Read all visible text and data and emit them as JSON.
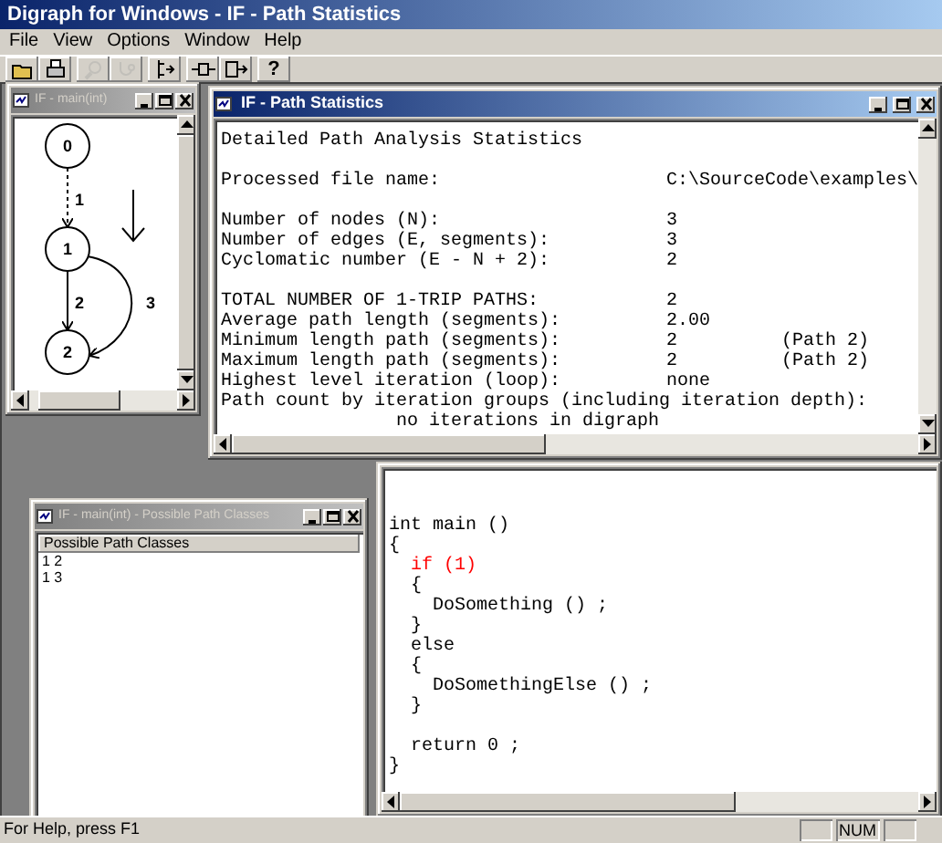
{
  "window": {
    "title": "Digraph for Windows - IF - Path Statistics"
  },
  "menu": [
    "File",
    "View",
    "Options",
    "Window",
    "Help"
  ],
  "toolbar": [
    {
      "kind": "open",
      "disabled": false
    },
    {
      "kind": "print",
      "disabled": false
    },
    {
      "kind": "zoom",
      "disabled": true
    },
    {
      "kind": "curve",
      "disabled": true
    },
    {
      "kind": "split",
      "disabled": false
    },
    {
      "kind": "node",
      "disabled": false
    },
    {
      "kind": "move",
      "disabled": false
    },
    {
      "kind": "help",
      "label": "?",
      "disabled": false
    }
  ],
  "graph_window": {
    "title": "IF - main(int)",
    "active": false,
    "nodes": [
      {
        "label": "0"
      },
      {
        "label": "1"
      },
      {
        "label": "2"
      }
    ],
    "edges": [
      {
        "kind": "dotted",
        "label": "1"
      },
      {
        "kind": "straight",
        "label": "2"
      },
      {
        "kind": "curved",
        "label": "3"
      }
    ]
  },
  "stats_window": {
    "title": "IF - Path Statistics",
    "active": true,
    "sections": [
      [
        {
          "kind": "line",
          "label": "Detailed Path Analysis Statistics"
        }
      ],
      [
        {
          "kind": "pair",
          "label": "Processed file name:",
          "value": "C:\\SourceCode\\examples\\"
        }
      ],
      [
        {
          "kind": "pair",
          "label": "Number of nodes (N):",
          "value": "3"
        },
        {
          "kind": "pair",
          "label": "Number of edges (E, segments):",
          "value": "3"
        },
        {
          "kind": "pair",
          "label": "Cyclomatic number (E - N + 2):",
          "value": "2"
        }
      ],
      [
        {
          "kind": "pair",
          "label": "TOTAL NUMBER OF 1-TRIP PATHS:",
          "value": "2"
        },
        {
          "kind": "pair",
          "label": "Average path length (segments):",
          "value": "2.00"
        },
        {
          "kind": "pair",
          "label": "Minimum length path (segments):",
          "value": "2",
          "note": "(Path 2)"
        },
        {
          "kind": "pair",
          "label": "Maximum length path (segments):",
          "value": "2",
          "note": "(Path 2)"
        },
        {
          "kind": "pair",
          "label": "Highest level iteration (loop):",
          "value": "none"
        },
        {
          "kind": "line",
          "label": "Path count by iteration groups (including iteration depth):"
        },
        {
          "kind": "indented",
          "label": "no iterations in digraph"
        }
      ]
    ]
  },
  "classes_window": {
    "title": "IF - main(int) - Possible Path Classes",
    "active": false,
    "header": "Possible Path Classes",
    "rows": [
      "1 2",
      "1 3"
    ]
  },
  "code_window": {
    "lines": [
      {
        "kind": "code",
        "text": "int main ()",
        "highlighted": false
      },
      {
        "kind": "code",
        "text": "{",
        "highlighted": false
      },
      {
        "kind": "code",
        "text": "  if (1)",
        "highlighted": true
      },
      {
        "kind": "code",
        "text": "  {",
        "highlighted": false
      },
      {
        "kind": "code",
        "text": "    DoSomething () ;",
        "highlighted": false
      },
      {
        "kind": "code",
        "text": "  }",
        "highlighted": false
      },
      {
        "kind": "code",
        "text": "  else",
        "highlighted": false
      },
      {
        "kind": "code",
        "text": "  {",
        "highlighted": false
      },
      {
        "kind": "code",
        "text": "    DoSomethingElse () ;",
        "highlighted": false
      },
      {
        "kind": "code",
        "text": "  }",
        "highlighted": false
      },
      {
        "kind": "blank"
      },
      {
        "kind": "code",
        "text": "  return 0 ;",
        "highlighted": false
      },
      {
        "kind": "code",
        "text": "}",
        "highlighted": false
      }
    ]
  },
  "status_bar": {
    "text": "For Help, press F1",
    "indicators": [
      {
        "kind": "blank"
      },
      {
        "kind": "text",
        "text": "NUM"
      },
      {
        "kind": "blank"
      }
    ]
  }
}
